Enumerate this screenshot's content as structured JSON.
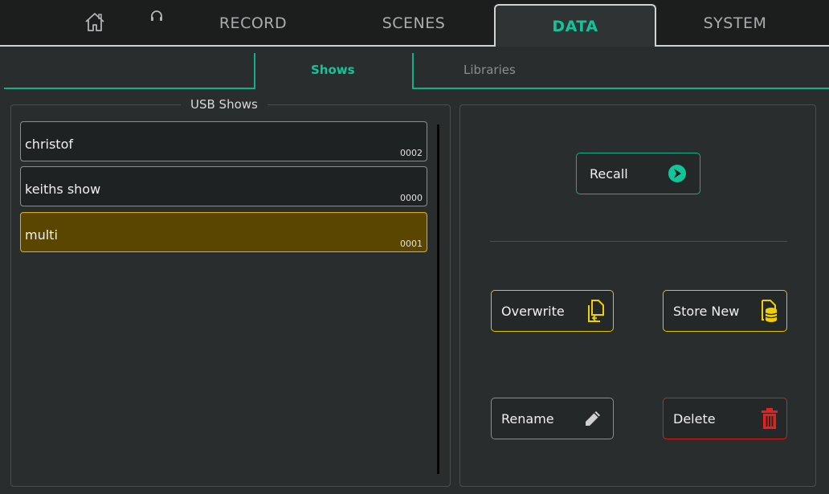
{
  "tabs": [
    {
      "label": "RECORD"
    },
    {
      "label": "SCENES"
    },
    {
      "label": "DATA"
    },
    {
      "label": "SYSTEM"
    }
  ],
  "subtabs": [
    {
      "label": "Shows"
    },
    {
      "label": "Libraries"
    }
  ],
  "left_panel": {
    "title": "USB Shows",
    "items": [
      {
        "name": "christof",
        "number": "0002"
      },
      {
        "name": "keiths show",
        "number": "0000"
      },
      {
        "name": "multi",
        "number": "0001"
      }
    ]
  },
  "actions": {
    "recall": "Recall",
    "overwrite": "Overwrite",
    "store_new": "Store New",
    "rename": "Rename",
    "delete": "Delete"
  },
  "colors": {
    "accent_teal": "#12c49a",
    "selected_fill": "#5a4600",
    "selected_border": "#e0b100",
    "delete_red": "#e81f1f"
  },
  "icons": [
    "home-icon",
    "headphones-icon",
    "play-icon",
    "overwrite-icon",
    "store-new-icon",
    "pencil-icon",
    "trash-icon"
  ]
}
